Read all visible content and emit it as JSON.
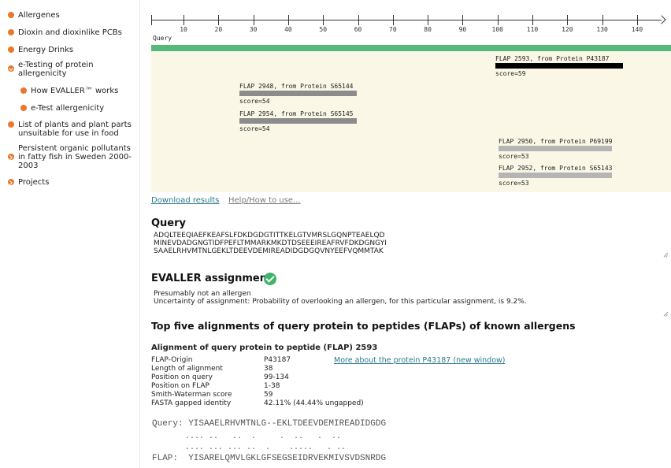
{
  "sidebar": {
    "items": [
      {
        "label": "Allergenes"
      },
      {
        "label": "Dioxin and dioxinlike PCBs"
      },
      {
        "label": "Energy Drinks"
      },
      {
        "label": "e-Testing of protein allergenicity"
      },
      {
        "label": "How EVALLER™ works"
      },
      {
        "label": "e-Test allergenicity"
      },
      {
        "label": "List of plants and plant parts unsuitable for use in food"
      },
      {
        "label": "Persistent organic pollutants in fatty fish in Sweden 2000-2003"
      },
      {
        "label": "Projects"
      }
    ]
  },
  "ruler": {
    "ticks": [
      "10",
      "20",
      "30",
      "40",
      "50",
      "60",
      "70",
      "80",
      "90",
      "100",
      "110",
      "120",
      "130",
      "140"
    ],
    "query_label": "Query"
  },
  "flaps": [
    {
      "label": "FLAP 2593, from Protein P43187",
      "score": "score=59",
      "color": "#000000"
    },
    {
      "label": "FLAP 2948, from Protein S65144",
      "score": "score=54",
      "color": "#8c8c8c"
    },
    {
      "label": "FLAP 2954, from Protein S65145",
      "score": "score=54",
      "color": "#8c8c8c"
    },
    {
      "label": "FLAP 2950, from Protein P69199",
      "score": "score=53",
      "color": "#b5b5b5"
    },
    {
      "label": "FLAP 2952, from Protein S65143",
      "score": "score=53",
      "color": "#b5b5b5"
    }
  ],
  "links": {
    "download": "Download results",
    "help": "Help/How to use..."
  },
  "query": {
    "title": "Query",
    "sequence": "ADQLTEEQIAEFKEAFSLFDKDGDGTITTKELGTVMRSLGQNPTEAELQD\nMINEVDADGNGTIDFPEFLTMMARKMKDTDSEEEIREAFRVFDKDGNGYI\nSAAELRHVMTNLGEKLTDEEVDEMIREADIDGDGQVNYEEFVQMMTAK"
  },
  "assignment": {
    "title": "EVALLER assignment",
    "text": "Presumably not an allergen\nUncertainty of assignment: Probability of overlooking an allergen, for this particular assignment, is 9.2%."
  },
  "alignments": {
    "title": "Top five alignments of query protein to peptides (FLAPs) of known allergens",
    "first": {
      "title": "Alignment of query protein to peptide (FLAP) 2593",
      "rows": [
        {
          "key": "FLAP-Origin",
          "value": "P43187"
        },
        {
          "key": "Length of alignment",
          "value": "38"
        },
        {
          "key": "Position on query",
          "value": "99-134"
        },
        {
          "key": "Position on FLAP",
          "value": "1-38"
        },
        {
          "key": "Smith-Waterman score",
          "value": "59"
        },
        {
          "key": "FASTA gapped identity",
          "value": "42.11% (44.44% ungapped)"
        }
      ],
      "more_link": "More about the protein P43187 (new window)",
      "query_line": "Query: YISAAELRHVMTNLG--EKLTDEEVDEMIREADIDGDG",
      "match_line1": "       .... ..   ..  .     .  ..   .  ..",
      "match_line2": "       .... ... ... ..  .    .....   . ..",
      "flap_line": "FLAP:  YISARELQMVLGKLGFSEGSEIDRVEKMIVSVDSNRDG"
    }
  },
  "colors": {
    "accent": "#e8782b",
    "query_bar": "#55b87c",
    "link": "#2a7a8c",
    "panel": "#fbf7e6"
  }
}
